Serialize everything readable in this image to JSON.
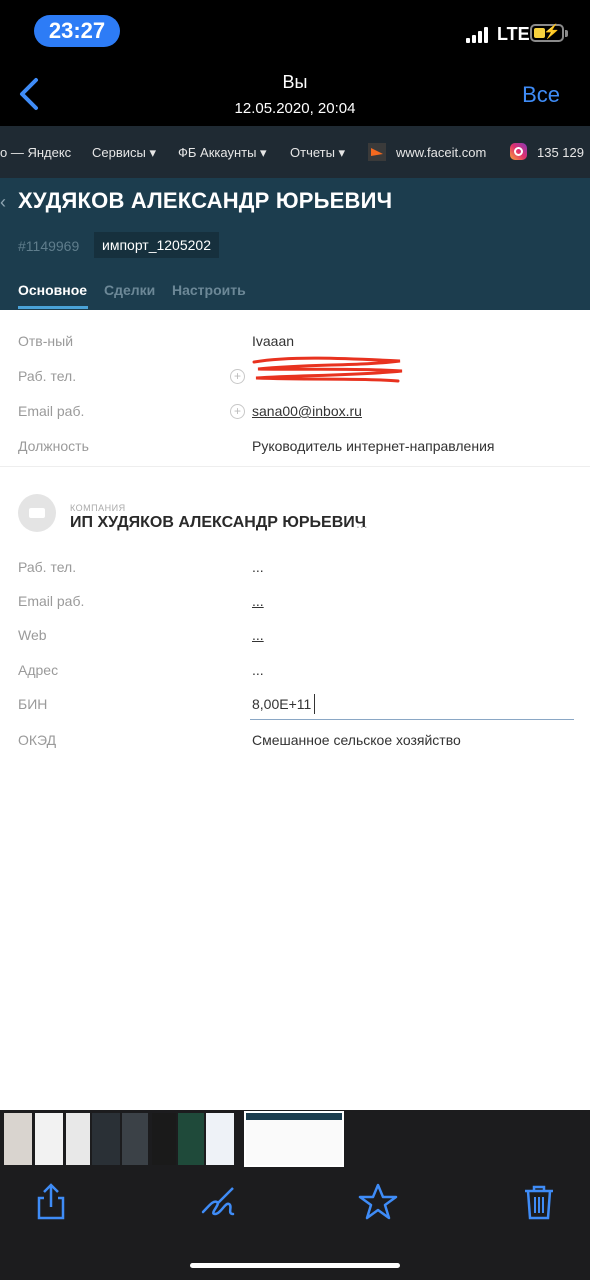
{
  "status_bar": {
    "time": "23:27",
    "network": "LTE",
    "time_pill_color": "#2d7cf6",
    "battery_color": "#f7d23e"
  },
  "nav": {
    "title": "Вы",
    "subtitle": "12.05.2020, 20:04",
    "right_label": "Все",
    "accent": "#3f8cf7"
  },
  "photo": {
    "bookmarks": [
      {
        "label": "о — Яндекс"
      },
      {
        "label": "Сервисы ▾"
      },
      {
        "label": "ФБ Аккаунты ▾"
      },
      {
        "label": "Отчеты ▾"
      },
      {
        "label": "www.faceit.com"
      },
      {
        "label": "135 129"
      }
    ],
    "header": {
      "name": "ХУДЯКОВ АЛЕКСАНДР ЮРЬЕВИЧ",
      "id": "#1149969",
      "tag": "импорт_1205202",
      "tabs": [
        {
          "label": "Основное",
          "active": true
        },
        {
          "label": "Сделки",
          "active": false
        },
        {
          "label": "Настроить",
          "active": false
        }
      ],
      "bg_color": "#1c3d4e"
    },
    "contact_fields": [
      {
        "label": "Отв-ный",
        "value": "Ivaaan"
      },
      {
        "label": "Раб. тел.",
        "value": ""
      },
      {
        "label": "Email раб.",
        "value": "sana00@inbox.ru"
      },
      {
        "label": "Должность",
        "value": "Руководитель интернет-направления"
      }
    ],
    "company": {
      "caption": "КОМПАНИЯ",
      "name": "ИП ХУДЯКОВ АЛЕКСАНДР ЮРЬЕВИЧ",
      "more": "...",
      "fields": [
        {
          "label": "Раб. тел.",
          "value": "..."
        },
        {
          "label": "Email раб.",
          "value": "..."
        },
        {
          "label": "Web",
          "value": "..."
        },
        {
          "label": "Адрес",
          "value": "..."
        },
        {
          "label": "БИН",
          "value": "8,00E+11"
        },
        {
          "label": "ОКЭД",
          "value": "Смешанное сельское хозяйство"
        }
      ]
    }
  },
  "toolbar": {
    "icons": [
      "share-icon",
      "markup-icon",
      "favorite-icon",
      "trash-icon"
    ],
    "icon_color": "#3f8cf7"
  }
}
